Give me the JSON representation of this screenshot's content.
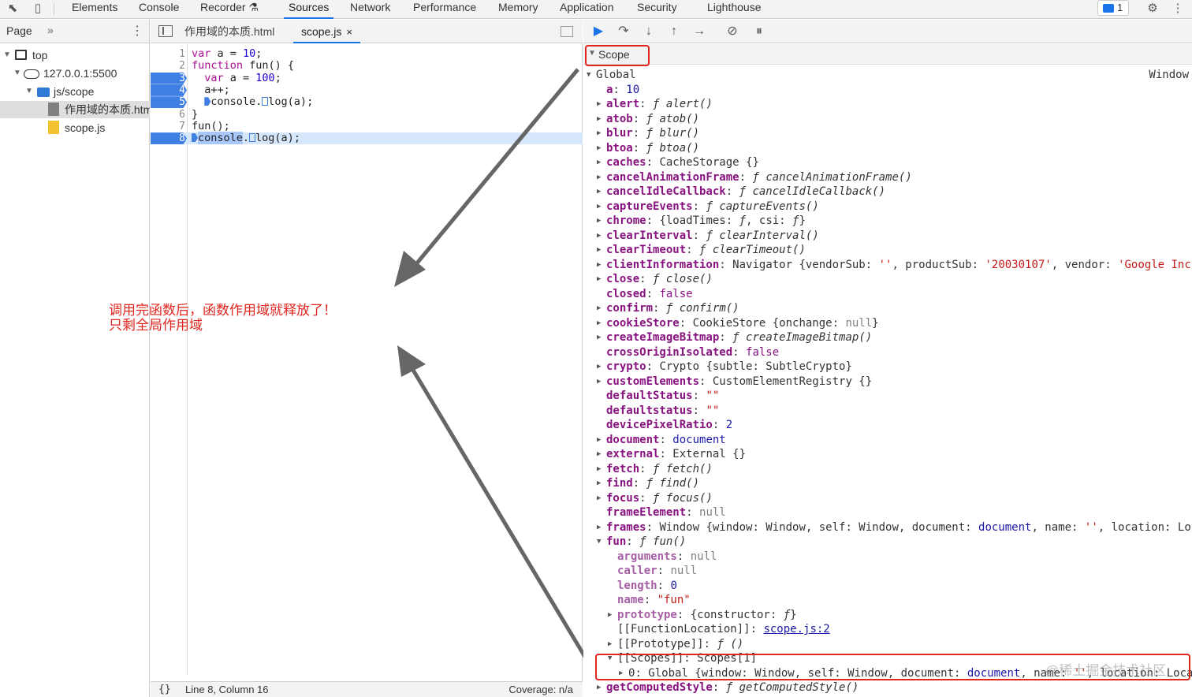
{
  "toolbar": {
    "tabs": [
      "Elements",
      "Console",
      "Recorder",
      "Sources",
      "Network",
      "Performance",
      "Memory",
      "Application",
      "Security",
      "Lighthouse"
    ],
    "issues_count": "1"
  },
  "navigator": {
    "header_label": "Page",
    "tree": [
      "top",
      "127.0.0.1:5500",
      "js/scope",
      "作用域的本质.htm",
      "scope.js"
    ]
  },
  "editor": {
    "tabs": [
      "作用域的本质.html",
      "scope.js"
    ],
    "close_glyph": "×",
    "status": {
      "braces": "{}",
      "position": "Line 8, Column 16",
      "coverage": "Coverage: n/a"
    }
  },
  "annotation": {
    "line1": "调用完函数后，函数作用域就释放了！",
    "line2": "只剩全局作用域"
  },
  "scope": {
    "title": "Scope",
    "global_label": "Global",
    "global_type": "Window"
  },
  "watermark": "@稀土掘金技术社区",
  "colors": {
    "accent": "#1a73e8",
    "breakpoint": "#3f7ee2",
    "annotation_red": "#e0261f",
    "property_name": "#881280"
  }
}
